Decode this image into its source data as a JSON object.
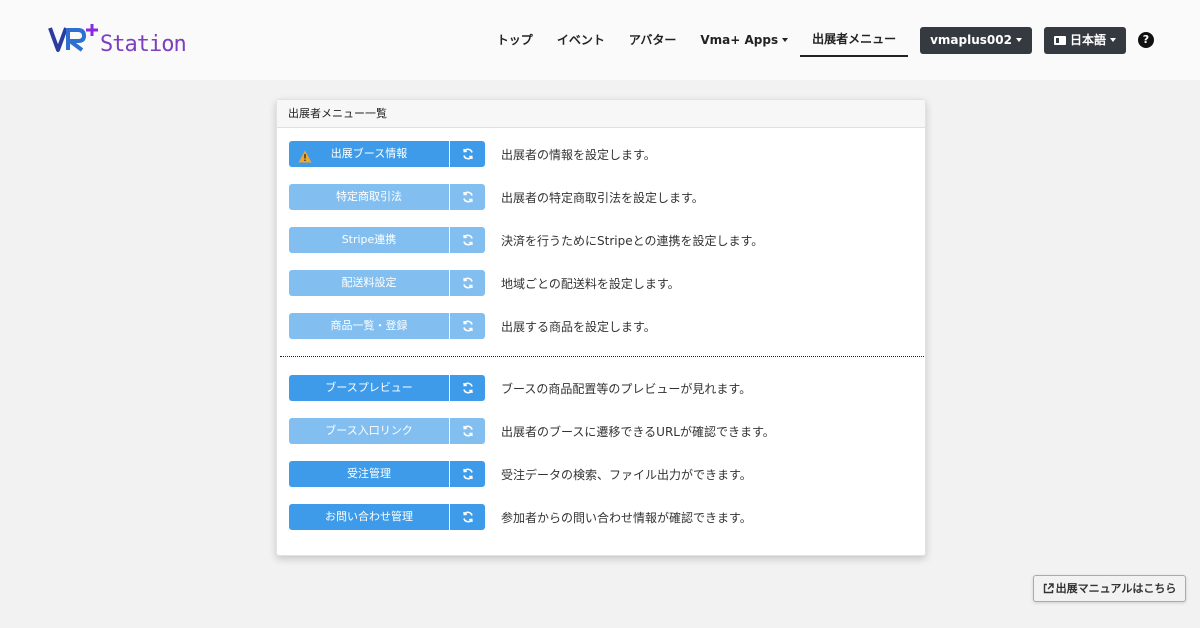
{
  "header": {
    "logo_text": "VR+ Station",
    "nav": [
      {
        "label": "トップ",
        "dropdown": false,
        "active": false
      },
      {
        "label": "イベント",
        "dropdown": false,
        "active": false
      },
      {
        "label": "アバター",
        "dropdown": false,
        "active": false
      },
      {
        "label": "Vma+ Apps",
        "dropdown": true,
        "active": false
      },
      {
        "label": "出展者メニュー",
        "dropdown": false,
        "active": true
      }
    ],
    "user_label": "vmaplus002",
    "language_label": "日本語",
    "help_icon": "question-circle-icon"
  },
  "card": {
    "title": "出展者メニュー一覧",
    "items": [
      {
        "label": "出展ブース情報",
        "description": "出展者の情報を設定します。",
        "style": "dark",
        "warning": true
      },
      {
        "label": "特定商取引法",
        "description": "出展者の特定商取引法を設定します。",
        "style": "light",
        "warning": false
      },
      {
        "label": "Stripe連携",
        "description": "決済を行うためにStripeとの連携を設定します。",
        "style": "light",
        "warning": false
      },
      {
        "label": "配送料設定",
        "description": "地域ごとの配送料を設定します。",
        "style": "light",
        "warning": false
      },
      {
        "label": "商品一覧・登録",
        "description": "出展する商品を設定します。",
        "style": "light",
        "warning": false
      },
      {
        "label": "ブースプレビュー",
        "description": "ブースの商品配置等のプレビューが見れます。",
        "style": "dark",
        "warning": false
      },
      {
        "label": "ブース入口リンク",
        "description": "出展者のブースに遷移できるURLが確認できます。",
        "style": "light",
        "warning": false
      },
      {
        "label": "受注管理",
        "description": "受注データの検索、ファイル出力ができます。",
        "style": "dark",
        "warning": false
      },
      {
        "label": "お問い合わせ管理",
        "description": "参加者からの問い合わせ情報が確認できます。",
        "style": "dark",
        "warning": false
      }
    ],
    "sync_icon": "sync-icon",
    "warning_icon": "warning-icon"
  },
  "manual_button": {
    "label": "出展マニュアルはこちら",
    "icon": "external-link-icon"
  },
  "colors": {
    "button_dark": "#3d9be9",
    "button_light": "#82bff0",
    "dropdown_bg": "#343a40",
    "warning": "#f0a92c",
    "logo_blue": "#2a3d9e",
    "logo_purple": "#8a2be2"
  }
}
